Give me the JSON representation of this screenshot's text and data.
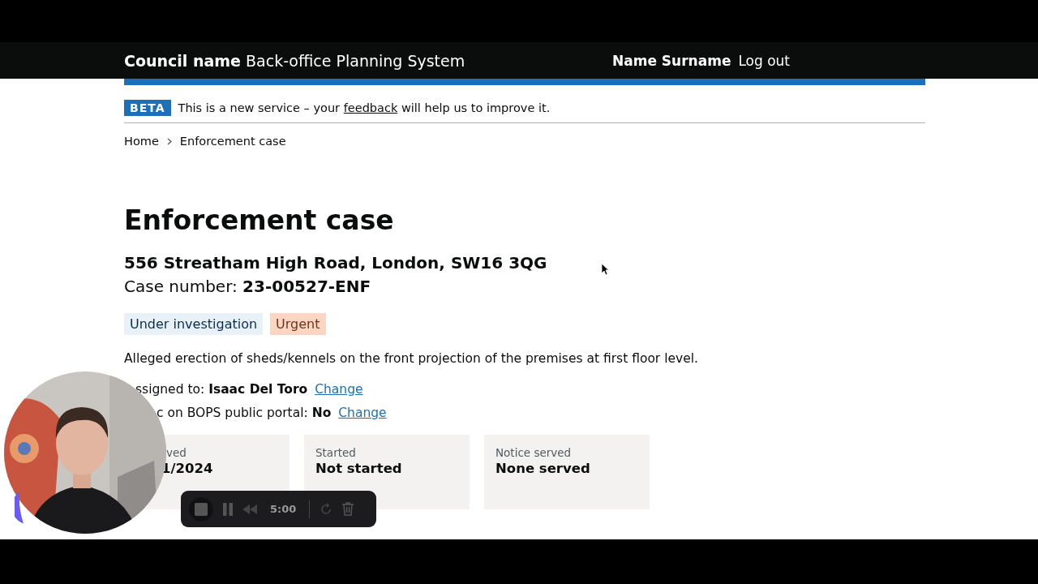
{
  "header": {
    "council": "Council name",
    "service": "Back-office Planning System",
    "user": "Name Surname",
    "logout": "Log out"
  },
  "phase_banner": {
    "tag": "BETA",
    "before": "This is a new service – your",
    "link": "feedback",
    "after": "will help us to improve it."
  },
  "breadcrumbs": [
    "Home",
    "Enforcement case"
  ],
  "title": "Enforcement case",
  "address": "556 Streatham High Road, London, SW16 3QG",
  "case_number": {
    "label": "Case number:",
    "value": "23-00527-ENF"
  },
  "tags": [
    {
      "label": "Under investigation",
      "color": "#e8f1f8"
    },
    {
      "label": "Urgent",
      "color": "#fcd6c3"
    }
  ],
  "description": "Alleged erection of sheds/kennels on the front projection of the premises at first floor level.",
  "details": [
    {
      "label": "ssigned to:",
      "value": "Isaac Del Toro",
      "action": "Change"
    },
    {
      "label": "c on BOPS public portal:",
      "value": "No",
      "action": "Change"
    }
  ],
  "cards": [
    {
      "label": "ved",
      "value": "1/2024"
    },
    {
      "label": "Started",
      "value": "Not started"
    },
    {
      "label": "Notice served",
      "value": "None served"
    }
  ],
  "recorder": {
    "time": "5:00"
  }
}
